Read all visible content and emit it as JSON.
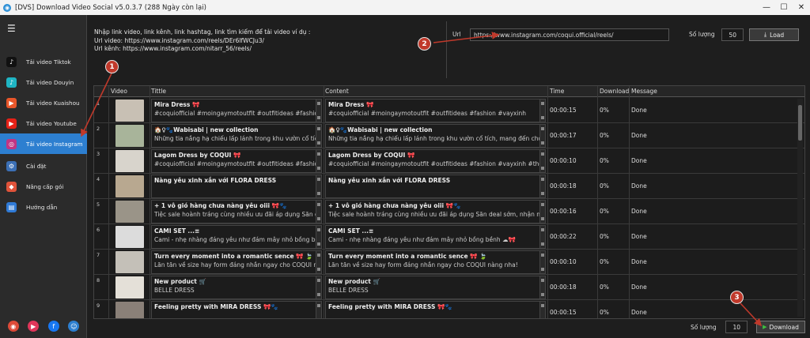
{
  "window": {
    "title": "[DVS] Download Video Social v5.0.3.7 (288 Ngày còn lại)",
    "controls": [
      "—",
      "☐",
      "✕"
    ]
  },
  "sidebar": {
    "menu_icon": "☰",
    "items": [
      {
        "label": "Tải video Tiktok",
        "icon": "tiktok-icon",
        "color": "#111111",
        "glyph": "♪"
      },
      {
        "label": "Tải video Douyin",
        "icon": "douyin-icon",
        "color": "#1fb5c4",
        "glyph": "♪"
      },
      {
        "label": "Tải video Kuaishou",
        "icon": "kuaishou-icon",
        "color": "#e8562a",
        "glyph": "▶"
      },
      {
        "label": "Tải video Youtube",
        "icon": "youtube-icon",
        "color": "#e62117",
        "glyph": "▶"
      },
      {
        "label": "Tải video Instagram",
        "icon": "instagram-icon",
        "color": "#c13584",
        "glyph": "◎",
        "active": true
      },
      {
        "label": "Cài đặt",
        "icon": "gear-icon",
        "color": "#3b6fb5",
        "glyph": "⚙"
      },
      {
        "label": "Nâng cấp gói",
        "icon": "upgrade-icon",
        "color": "#e0533a",
        "glyph": "◆"
      },
      {
        "label": "Hướng dẫn",
        "icon": "guide-icon",
        "color": "#2f7ad6",
        "glyph": "▤"
      }
    ],
    "bottom_icons": [
      {
        "icon": "chrome-icon",
        "color": "#dd4b39",
        "glyph": "◉"
      },
      {
        "icon": "app-icon",
        "color": "#e0365a",
        "glyph": "▶"
      },
      {
        "icon": "facebook-icon",
        "color": "#1877f2",
        "glyph": "f"
      },
      {
        "icon": "support-icon",
        "color": "#2d7fd0",
        "glyph": "☺"
      }
    ]
  },
  "instructions": {
    "line1": "Nhập link video, link kênh, link hashtag, link tìm kiếm để tải video ví dụ :",
    "line2": "Url video: https://www.instagram.com/reels/DEr6lfWCJu3/",
    "line3": "Url kênh: https://www.instagram.com/nitarr_56/reels/"
  },
  "urlbar": {
    "label": "Url",
    "value": "https://www.instagram.com/coqui.official/reels/",
    "qty_label": "Số lượng",
    "qty_value": "50",
    "load_label": "Load",
    "load_icon": "⤓"
  },
  "table": {
    "headers": {
      "video": "Video",
      "title": "Tittle",
      "content": "Content",
      "time": "Time",
      "download": "Download",
      "message": "Message"
    },
    "rows": [
      {
        "num": "1",
        "thumb": "#c8c0b4",
        "title1": "Mira Dress 🎀",
        "title2": "#coquiofficial #moingaymotoutfit #outfitideas #fashion",
        "content1": "Mira Dress 🎀",
        "content2": "#coquiofficial #moingaymotoutfit #outfitideas #fashion #vayxinh",
        "time": "00:00:15",
        "dl": "0%",
        "msg": "Done"
      },
      {
        "num": "2",
        "thumb": "#a8b49a",
        "title1": "🏠♀🐾Wabisabi | new collection",
        "title2": "Những tia nắng hạ chiếu lấp lánh trong khu vườn cổ tích",
        "content1": "🏠♀🐾Wabisabi | new collection",
        "content2": "Những tia nắng hạ chiếu lấp lánh trong khu vườn cổ tích, mang đến cho bạn",
        "time": "00:00:17",
        "dl": "0%",
        "msg": "Done"
      },
      {
        "num": "3",
        "thumb": "#d8d4cc",
        "title1": "Lagom Dress by COQUI 🎀",
        "title2": "#coquiofficial #moingaymotoutfit #outfitideas #fashion",
        "content1": "Lagom Dress by COQUI 🎀",
        "content2": "#coquiofficial #moingaymotoutfit #outfitideas #fashion #vayxinh #thoitrang",
        "time": "00:00:10",
        "dl": "0%",
        "msg": "Done"
      },
      {
        "num": "4",
        "thumb": "#b8a890",
        "title1": "Nàng yêu xinh xắn với FLORA DRESS",
        "title2": "",
        "content1": "Nàng yêu xinh xắn với FLORA DRESS",
        "content2": "",
        "time": "00:00:18",
        "dl": "0%",
        "msg": "Done"
      },
      {
        "num": "5",
        "thumb": "#9a9488",
        "title1": "+ 1 vô gió hàng chưa nàng yêu oiii 🎀🐾",
        "title2": "Tiệc sale hoành tráng cùng nhiều ưu đãi áp dụng Săn de",
        "content1": "+ 1 vô gió hàng chưa nàng yêu oiii 🎀🐾",
        "content2": "Tiệc sale hoành tráng cùng nhiều ưu đãi áp dụng Săn deal sớm, nhận ngay r",
        "time": "00:00:16",
        "dl": "0%",
        "msg": "Done"
      },
      {
        "num": "6",
        "thumb": "#dcdcdc",
        "title1": "CAMI SET ...≡",
        "title2": "Cami - nhẹ nhàng đáng yêu như đám mây nhỏ bồng bềnh",
        "content1": "CAMI SET ...≡",
        "content2": "Cami - nhẹ nhàng đáng yêu như đám mây nhỏ bồng bềnh ☁🎀",
        "time": "00:00:22",
        "dl": "0%",
        "msg": "Done"
      },
      {
        "num": "7",
        "thumb": "#c4c0b8",
        "title1": "Turn every moment into a romantic sence 🎀 🍃",
        "title2": "Lăn tăn về size hay form đáng nhắn ngay cho COQUI nà",
        "content1": "Turn every moment into a romantic sence 🎀 🍃",
        "content2": "Lăn tăn về size hay form đáng nhắn ngay cho COQUI nàng nha!",
        "time": "00:00:10",
        "dl": "0%",
        "msg": "Done"
      },
      {
        "num": "8",
        "thumb": "#e4e0d8",
        "title1": "New product 🛒",
        "title2": "BELLE DRESS",
        "content1": "New product 🛒",
        "content2": "BELLE DRESS",
        "time": "00:00:18",
        "dl": "0%",
        "msg": "Done"
      },
      {
        "num": "9",
        "thumb": "#8a8078",
        "title1": "Feeling pretty with MIRA DRESS 🎀🐾",
        "title2": "",
        "content1": "Feeling pretty with MIRA DRESS 🎀🐾",
        "content2": "",
        "time": "00:00:15",
        "dl": "0%",
        "msg": "Done"
      }
    ]
  },
  "footer": {
    "qty_label": "Số lượng",
    "qty_value": "10",
    "download_label": "Download",
    "download_icon": "▶"
  },
  "markers": [
    "1",
    "2",
    "3"
  ],
  "accent": "#2d7fd0",
  "marker_color": "#c0392b"
}
